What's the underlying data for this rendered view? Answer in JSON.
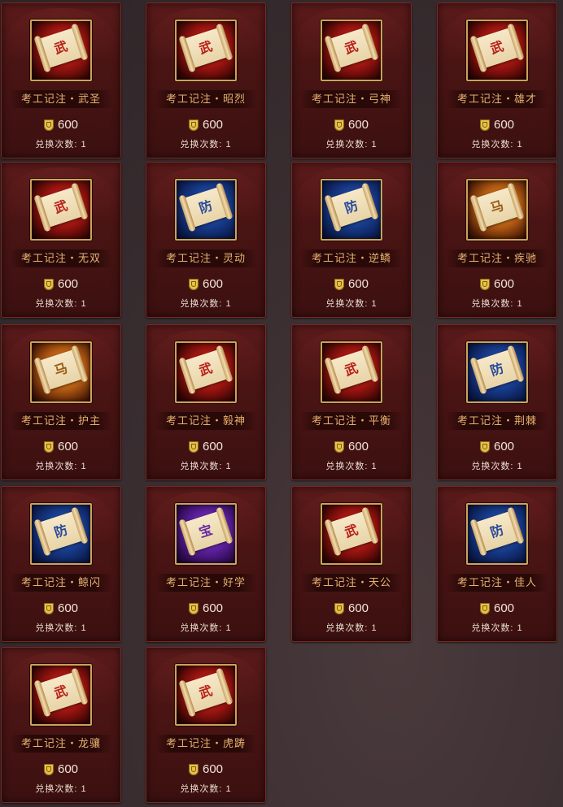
{
  "currency": {
    "icon": "shield-coin-icon",
    "color": "#e8c24a"
  },
  "items": [
    {
      "name": "考工记注・武圣",
      "price": "600",
      "limit": "兑换次数: 1",
      "glyph": "武",
      "theme": "red"
    },
    {
      "name": "考工记注・昭烈",
      "price": "600",
      "limit": "兑换次数: 1",
      "glyph": "武",
      "theme": "red"
    },
    {
      "name": "考工记注・弓神",
      "price": "600",
      "limit": "兑换次数: 1",
      "glyph": "武",
      "theme": "red"
    },
    {
      "name": "考工记注・雄才",
      "price": "600",
      "limit": "兑换次数: 1",
      "glyph": "武",
      "theme": "red"
    },
    {
      "name": "考工记注・无双",
      "price": "600",
      "limit": "兑换次数: 1",
      "glyph": "武",
      "theme": "red"
    },
    {
      "name": "考工记注・灵动",
      "price": "600",
      "limit": "兑换次数: 1",
      "glyph": "防",
      "theme": "blue"
    },
    {
      "name": "考工记注・逆鳞",
      "price": "600",
      "limit": "兑换次数: 1",
      "glyph": "防",
      "theme": "blue"
    },
    {
      "name": "考工记注・疾驰",
      "price": "600",
      "limit": "兑换次数: 1",
      "glyph": "马",
      "theme": "gold"
    },
    {
      "name": "考工记注・护主",
      "price": "600",
      "limit": "兑换次数: 1",
      "glyph": "马",
      "theme": "gold"
    },
    {
      "name": "考工记注・毅神",
      "price": "600",
      "limit": "兑换次数: 1",
      "glyph": "武",
      "theme": "red"
    },
    {
      "name": "考工记注・平衡",
      "price": "600",
      "limit": "兑换次数: 1",
      "glyph": "武",
      "theme": "red"
    },
    {
      "name": "考工记注・荆棘",
      "price": "600",
      "limit": "兑换次数: 1",
      "glyph": "防",
      "theme": "blue"
    },
    {
      "name": "考工记注・鲸闪",
      "price": "600",
      "limit": "兑换次数: 1",
      "glyph": "防",
      "theme": "blue"
    },
    {
      "name": "考工记注・好学",
      "price": "600",
      "limit": "兑换次数: 1",
      "glyph": "宝",
      "theme": "purple"
    },
    {
      "name": "考工记注・天公",
      "price": "600",
      "limit": "兑换次数: 1",
      "glyph": "武",
      "theme": "red"
    },
    {
      "name": "考工记注・佳人",
      "price": "600",
      "limit": "兑换次数: 1",
      "glyph": "防",
      "theme": "blue"
    },
    {
      "name": "考工记注・龙骧",
      "price": "600",
      "limit": "兑换次数: 1",
      "glyph": "武",
      "theme": "red"
    },
    {
      "name": "考工记注・虎踌",
      "price": "600",
      "limit": "兑换次数: 1",
      "glyph": "武",
      "theme": "red"
    }
  ]
}
